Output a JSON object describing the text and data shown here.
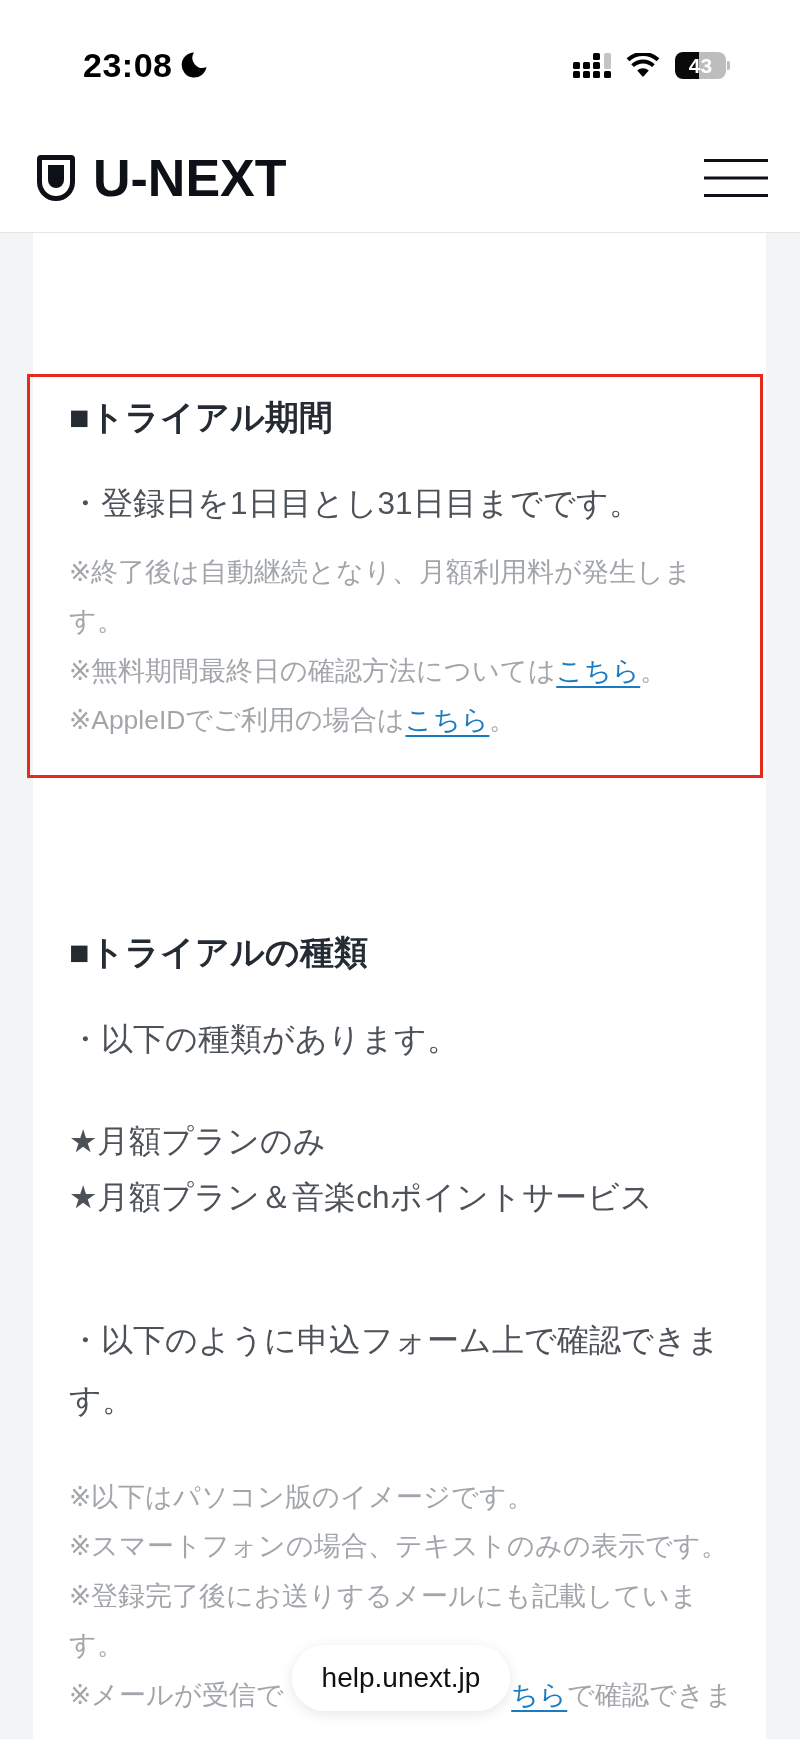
{
  "status_bar": {
    "time": "23:08",
    "battery": "43"
  },
  "header": {
    "logo": "U-NEXT"
  },
  "sections": [
    {
      "highlighted": true,
      "heading": "■トライアル期間",
      "blocks": [
        {
          "kind": "body",
          "lines": [
            "・登録日を1日目とし31日目までです。"
          ]
        },
        {
          "kind": "notes",
          "lines": [
            {
              "kind": "note",
              "text": "※終了後は自動継続となり、月額利用料が発生します。"
            },
            {
              "kind": "note",
              "text": "※無料期間最終日の確認方法については",
              "link": "こちら",
              "after": "。"
            },
            {
              "kind": "note",
              "text": "※AppleIDでご利用の場合は",
              "link": "こちら",
              "after": "。"
            }
          ]
        }
      ]
    },
    {
      "highlighted": false,
      "heading": "■トライアルの種類",
      "blocks": [
        {
          "kind": "body",
          "lines": [
            "・以下の種類があります。"
          ]
        },
        {
          "kind": "stars",
          "lines": [
            "★月額プランのみ",
            "★月額プラン＆音楽chポイントサービス"
          ]
        },
        {
          "kind": "body",
          "lines": [
            "・以下のように申込フォーム上で確認できます。"
          ]
        },
        {
          "kind": "notes",
          "lines": [
            {
              "kind": "note",
              "text": "※以下はパソコン版のイメージです。"
            },
            {
              "kind": "note",
              "text": "※スマートフォンの場合、テキストのみの表示です。"
            },
            {
              "kind": "note",
              "text": "※登録完了後にお送りするメールにも記載しています。"
            },
            {
              "kind": "covered",
              "text": "※メールが受信で",
              "link": "ちら",
              "after": "で確認できま"
            }
          ]
        }
      ]
    }
  ],
  "address_bar": {
    "url": "help.unext.jp"
  }
}
